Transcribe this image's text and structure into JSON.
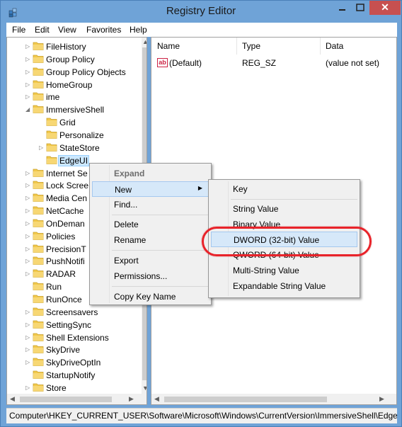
{
  "window": {
    "title": "Registry Editor",
    "close_label": "✕",
    "accent_color": "#6fa3d7"
  },
  "menubar": [
    "File",
    "Edit",
    "View",
    "Favorites",
    "Help"
  ],
  "tree": [
    {
      "label": "FileHistory",
      "level": 0,
      "toggle": "▷"
    },
    {
      "label": "Group Policy",
      "level": 0,
      "toggle": "▷"
    },
    {
      "label": "Group Policy Objects",
      "level": 0,
      "toggle": "▷"
    },
    {
      "label": "HomeGroup",
      "level": 0,
      "toggle": "▷"
    },
    {
      "label": "ime",
      "level": 0,
      "toggle": "▷"
    },
    {
      "label": "ImmersiveShell",
      "level": 0,
      "toggle": "◢"
    },
    {
      "label": "Grid",
      "level": 1,
      "toggle": ""
    },
    {
      "label": "Personalize",
      "level": 1,
      "toggle": ""
    },
    {
      "label": "StateStore",
      "level": 1,
      "toggle": "▷"
    },
    {
      "label": "EdgeUI",
      "level": 1,
      "toggle": "",
      "selected": true
    },
    {
      "label": "Internet Se",
      "level": 0,
      "toggle": "▷"
    },
    {
      "label": "Lock Scree",
      "level": 0,
      "toggle": "▷"
    },
    {
      "label": "Media Cen",
      "level": 0,
      "toggle": "▷"
    },
    {
      "label": "NetCache",
      "level": 0,
      "toggle": "▷"
    },
    {
      "label": "OnDeman",
      "level": 0,
      "toggle": "▷"
    },
    {
      "label": "Policies",
      "level": 0,
      "toggle": "▷"
    },
    {
      "label": "PrecisionT",
      "level": 0,
      "toggle": "▷"
    },
    {
      "label": "PushNotifi",
      "level": 0,
      "toggle": "▷"
    },
    {
      "label": "RADAR",
      "level": 0,
      "toggle": "▷"
    },
    {
      "label": "Run",
      "level": 0,
      "toggle": ""
    },
    {
      "label": "RunOnce",
      "level": 0,
      "toggle": ""
    },
    {
      "label": "Screensavers",
      "level": 0,
      "toggle": "▷"
    },
    {
      "label": "SettingSync",
      "level": 0,
      "toggle": "▷"
    },
    {
      "label": "Shell Extensions",
      "level": 0,
      "toggle": "▷"
    },
    {
      "label": "SkyDrive",
      "level": 0,
      "toggle": "▷"
    },
    {
      "label": "SkyDriveOptIn",
      "level": 0,
      "toggle": "▷"
    },
    {
      "label": "StartupNotify",
      "level": 0,
      "toggle": ""
    },
    {
      "label": "Store",
      "level": 0,
      "toggle": "▷"
    }
  ],
  "values_table": {
    "headers": {
      "name": "Name",
      "type": "Type",
      "data": "Data"
    },
    "rows": [
      {
        "icon": "ab",
        "name": "(Default)",
        "type": "REG_SZ",
        "data": "(value not set)"
      }
    ]
  },
  "context_menu": {
    "expand": "Expand",
    "new": "New",
    "find": "Find...",
    "delete": "Delete",
    "rename": "Rename",
    "export": "Export",
    "permissions": "Permissions...",
    "copy_key_name": "Copy Key Name"
  },
  "new_submenu": {
    "key": "Key",
    "string": "String Value",
    "binary": "Binary Value",
    "dword": "DWORD (32-bit) Value",
    "qword": "QWORD (64-bit) Value",
    "multi_string": "Multi-String Value",
    "expandable": "Expandable String Value"
  },
  "status_bar": "Computer\\HKEY_CURRENT_USER\\Software\\Microsoft\\Windows\\CurrentVersion\\ImmersiveShell\\EdgeUI",
  "highlight_color": "#e8232a"
}
